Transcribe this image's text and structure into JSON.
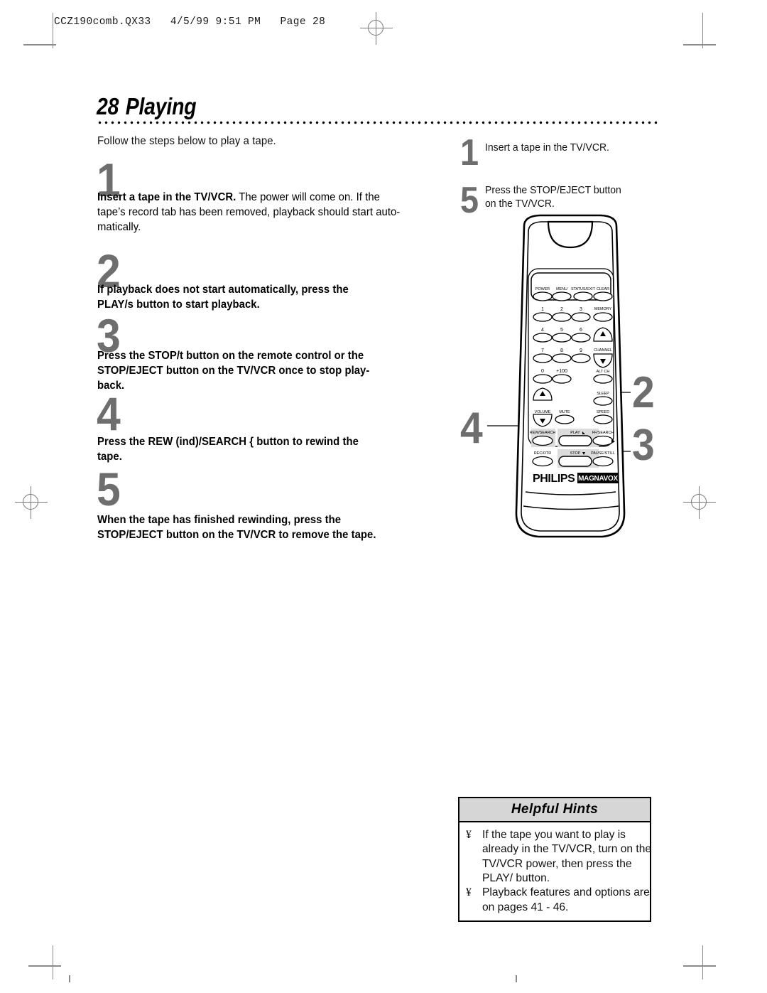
{
  "header": {
    "slug": "CCZ190comb.QX33   4/5/99 9:51 PM   Page 28"
  },
  "title": {
    "page_number": "28",
    "heading": "Playing"
  },
  "intro": "Follow the steps below to play a tape.",
  "steps": [
    {
      "number": "1",
      "lines": [
        {
          "bold_lead": "Insert a tape in the TV/VCR.",
          "rest": " The power will come on. If the"
        },
        {
          "bold_lead": "",
          "rest": "tape’s record tab has been removed, playback should start auto-"
        },
        {
          "bold_lead": "",
          "rest": "matically."
        }
      ]
    },
    {
      "number": "2",
      "all_bold": true,
      "lines": [
        {
          "rest": "If playback does not start automatically, press the"
        },
        {
          "rest": "PLAY/s  button to start playback."
        }
      ]
    },
    {
      "number": "3",
      "all_bold": true,
      "lines": [
        {
          "rest": "Press the STOP/t   button on the remote control or the"
        },
        {
          "rest": "STOP/EJECT button on the TV/VCR once to stop play-"
        },
        {
          "rest": "back."
        }
      ]
    },
    {
      "number": "4",
      "all_bold": true,
      "lines": [
        {
          "rest": "Press the REW (ind)/SEARCH {   button to rewind the"
        },
        {
          "rest": "tape."
        }
      ]
    },
    {
      "number": "5",
      "all_bold": true,
      "lines": [
        {
          "rest": "When the tape has finished rewinding, press the"
        },
        {
          "rest": "STOP/EJECT button on the TV/VCR to remove the tape."
        }
      ]
    }
  ],
  "right_steps": [
    {
      "number": "1",
      "lines": [
        "Insert a tape in the TV/VCR."
      ]
    },
    {
      "number": "5",
      "lines": [
        "Press the STOP/EJECT button",
        "on the TV/VCR."
      ]
    }
  ],
  "callouts": {
    "play": "2",
    "stop": "3",
    "rew": "4"
  },
  "remote": {
    "brand": "PHILIPS",
    "sub_brand": "MAGNAVOX",
    "buttons": {
      "power": "POWER",
      "menu": "MENU",
      "status_exit": "STATUS/EXIT",
      "clear": "CLEAR",
      "one": "1",
      "two": "2",
      "three": "3",
      "memory": "MEMORY",
      "four": "4",
      "five": "5",
      "six": "6",
      "seven": "7",
      "eight": "8",
      "nine": "9",
      "channel": "CHANNEL",
      "zero": "0",
      "plus100": "+100",
      "alt_ch": "ALT CH",
      "volume": "VOLUME",
      "mute": "MUTE",
      "sleep": "SLEEP",
      "speed": "SPEED",
      "rew_search": "REW/SEARCH",
      "play": "PLAY/",
      "ff_search": "FF/SEARCH",
      "rec_otr": "REC/OTR",
      "stop": "STOP/",
      "pause_still": "PAUSE/STILL"
    }
  },
  "hints": {
    "title": "Helpful Hints",
    "bullet_glyph": "¥",
    "items": [
      [
        "If the tape you want to play is",
        "already in the TV/VCR, turn on the",
        "TV/VCR power, then press the",
        "PLAY/ button."
      ],
      [
        "Playback features and options are",
        "on pages 41 - 46."
      ]
    ]
  },
  "colors": {
    "step_number_gray": "#6e6e6e",
    "hints_header_gray": "#d6d6d6",
    "mark_gray": "#8a8a8a",
    "button_fill": "#d9d9d9"
  }
}
